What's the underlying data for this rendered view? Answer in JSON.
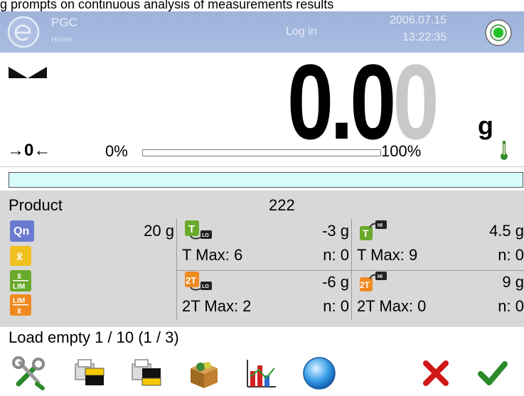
{
  "caption": "g prompts on continuous analysis of measurements results",
  "header": {
    "title": "PGC",
    "subtitle": "Home",
    "login": "Log in",
    "date": "2006.07.15",
    "time": "13:22:35"
  },
  "weighing": {
    "value_main": "0.0",
    "value_dim": "0",
    "unit": "g",
    "zero_symbol": "→0←",
    "bar_min": "0%",
    "bar_max": "100%",
    "bar_fill_fraction": 0
  },
  "product": {
    "label": "Product",
    "value": "222"
  },
  "stats": {
    "qn_value": "20 g",
    "t_lo_value": "-3 g",
    "t_lo_max": "T Max: 6",
    "t_lo_n": "n: 0",
    "t_hi_value": "4.5 g",
    "t_hi_max": "T Max: 9",
    "t_hi_n": "n: 0",
    "t2_lo_value": "-6 g",
    "t2_lo_max": "2T Max: 2",
    "t2_lo_n": "n: 0",
    "t2_hi_value": "9 g",
    "t2_hi_max": "2T Max: 0",
    "t2_hi_n": "n: 0"
  },
  "status_line": "Load empty 1 / 10 (1 / 3)",
  "icons": {
    "qn": "Qn",
    "xbar": "x̄",
    "xlim_top": "x̄",
    "xlim_bot": "LIM",
    "limx_top": "LIM",
    "limx_bot": "x̄",
    "t_badge": "T",
    "t2_badge": "2T",
    "lo": "LO",
    "hi": "HI"
  },
  "colors": {
    "header": "#a4b8df",
    "panel": "#d8d8d8",
    "cyan": "#d7fafa",
    "green": "#2a9a2a",
    "red": "#d01818"
  }
}
